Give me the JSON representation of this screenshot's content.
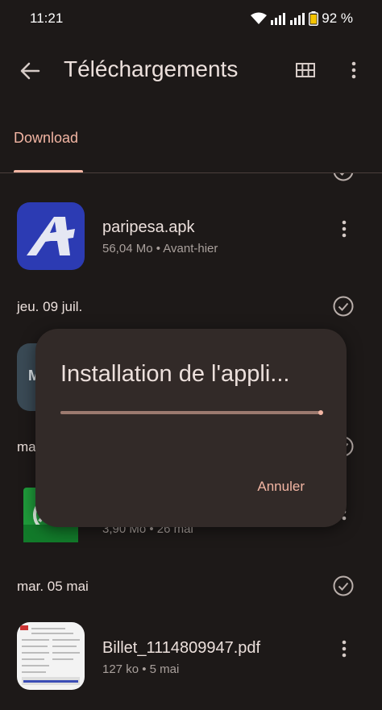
{
  "status": {
    "time": "11:21",
    "battery": "92 %"
  },
  "app_bar": {
    "title": "Téléchargements"
  },
  "tabs": [
    {
      "label": "Download"
    }
  ],
  "list": {
    "item1": {
      "name": "paripesa.apk",
      "meta": "56,04 Mo • Avant-hier"
    },
    "header1": "jeu. 09 juil.",
    "header2": "mar.",
    "item2_meta": "3,90 Mo • 26 mai",
    "header3": "mar. 05 mai",
    "item3": {
      "name": "Billet_1114809947.pdf",
      "meta": "127 ko • 5 mai"
    }
  },
  "dialog": {
    "title": "Installation de l'appli...",
    "cancel_label": "Annuler",
    "progress": 1.0
  },
  "colors": {
    "background": "#1d1918",
    "accent": "#f2b5a3",
    "dialog_bg": "#322a28",
    "paripesa_icon": "#2c3bb3"
  },
  "icons": [
    "back-arrow-icon",
    "grid-view-icon",
    "more-vert-icon",
    "check-circle-icon",
    "wifi-icon",
    "signal-icon",
    "battery-icon"
  ]
}
